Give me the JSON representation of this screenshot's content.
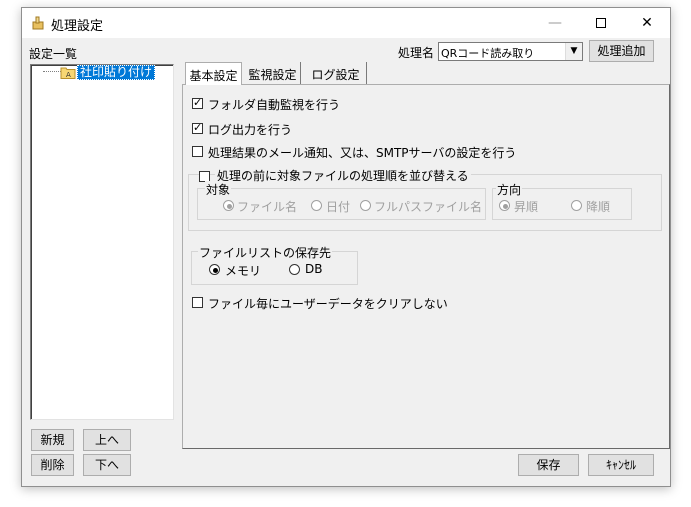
{
  "window": {
    "title": "処理設定",
    "controls": {
      "minimize": "—",
      "close": "✕"
    }
  },
  "sidebar": {
    "header": "設定一覧",
    "items": [
      {
        "label": "社印貼り付け",
        "selected": true
      }
    ],
    "buttons": {
      "new": "新規",
      "up": "上へ",
      "delete": "削除",
      "down": "下へ"
    }
  },
  "process": {
    "label": "処理名",
    "value": "QRコード読み取り",
    "add_button": "処理追加"
  },
  "tabs": [
    {
      "label": "基本設定",
      "active": true
    },
    {
      "label": "監視設定",
      "active": false
    },
    {
      "label": "ログ設定",
      "active": false
    }
  ],
  "basic": {
    "folder_watch": {
      "label": "フォルダ自動監視を行う",
      "checked": true
    },
    "log_output": {
      "label": "ログ出力を行う",
      "checked": true
    },
    "mail_notify": {
      "label": "処理結果のメール通知、又は、SMTPサーバの設定を行う",
      "checked": false
    },
    "sort": {
      "label": "処理の前に対象ファイルの処理順を並び替える",
      "checked": false,
      "target": {
        "caption": "対象",
        "options": [
          {
            "label": "ファイル名",
            "selected": true
          },
          {
            "label": "日付",
            "selected": false
          },
          {
            "label": "フルパスファイル名",
            "selected": false
          }
        ]
      },
      "direction": {
        "caption": "方向",
        "options": [
          {
            "label": "昇順",
            "selected": true
          },
          {
            "label": "降順",
            "selected": false
          }
        ]
      }
    },
    "file_list_storage": {
      "caption": "ファイルリストの保存先",
      "options": [
        {
          "label": "メモリ",
          "selected": true
        },
        {
          "label": "DB",
          "selected": false
        }
      ]
    },
    "keep_user_data": {
      "label": "ファイル毎にユーザーデータをクリアしない",
      "checked": false
    }
  },
  "footer": {
    "save": "保存",
    "cancel": "ｷｬﾝｾﾙ"
  }
}
